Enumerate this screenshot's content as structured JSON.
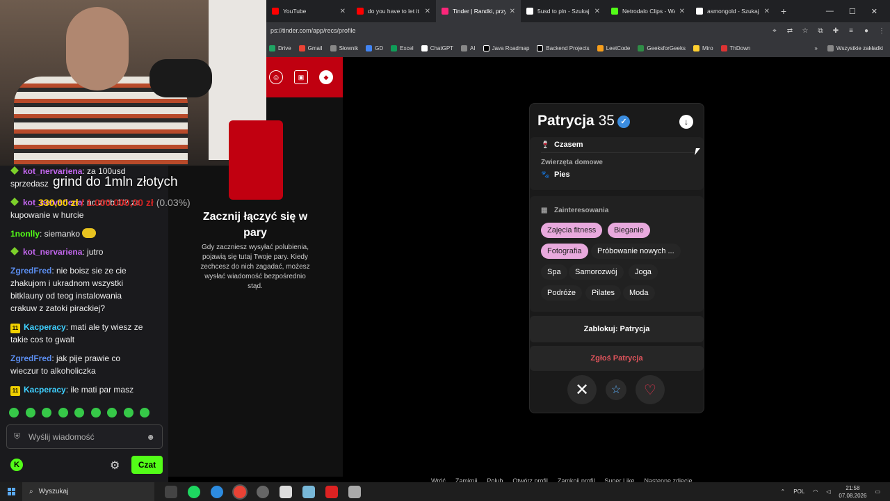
{
  "browser": {
    "tabs": [
      {
        "title": "YouTube",
        "color": "#ff0000",
        "active": false
      },
      {
        "title": "do you have to let it l...",
        "color": "#ff0000",
        "active": false
      },
      {
        "title": "Tinder | Randki, przyja...",
        "color": "#fd267a",
        "active": true
      },
      {
        "title": "5usd to pln - Szukaj w...",
        "color": "#ffffff",
        "active": false
      },
      {
        "title": "Netrodalo Clips - Wat...",
        "color": "#53fc18",
        "active": false
      },
      {
        "title": "asmongold - Szukaj w...",
        "color": "#ffffff",
        "active": false
      }
    ],
    "url": "ps://tinder.com/app/recs/profile",
    "bookmarks": [
      "Drive",
      "Gmail",
      "Słownik",
      "GD",
      "Excel",
      "ChatGPT",
      "AI",
      "Java Roadmap",
      "Backend Projects",
      "LeetCode",
      "GeeksforGeeks",
      "Miro",
      "ThDown"
    ],
    "bookmarks_all": "Wszystkie zakładki"
  },
  "tinder": {
    "empty_title": "Zacznij łączyć się w pary",
    "empty_desc": "Gdy zaczniesz wysyłać polubienia, pojawią się tutaj Twoje pary. Kiedy zechcesz do nich zagadać, możesz wysłać wiadomość bezpośrednio stąd.",
    "profile": {
      "name": "Patrycja",
      "age": "35",
      "drink_label": "Czasem",
      "pets_heading": "Zwierzęta domowe",
      "pets_value": "Pies",
      "interests_heading": "Zainteresowania",
      "interests": [
        {
          "label": "Zajęcia fitness",
          "highlight": true
        },
        {
          "label": "Bieganie",
          "highlight": true
        },
        {
          "label": "Fotografia",
          "highlight": true
        },
        {
          "label": "Próbowanie nowych ...",
          "highlight": false
        },
        {
          "label": "Spa",
          "highlight": false
        },
        {
          "label": "Samorozwój",
          "highlight": false
        },
        {
          "label": "Joga",
          "highlight": false
        },
        {
          "label": "Podróże",
          "highlight": false
        },
        {
          "label": "Pilates",
          "highlight": false
        },
        {
          "label": "Moda",
          "highlight": false
        }
      ],
      "block_label": "Zablokuj: Patrycja",
      "report_label": "Zgłoś Patrycja"
    }
  },
  "stream": {
    "overlay_text": "grind do 1mln złotych",
    "money_current": "330,00 zł",
    "money_goal": "/ 1.000.000,00 zł",
    "money_pct": "(0.03%)",
    "chat": [
      {
        "user": "kot_nervariena",
        "text": ": za 100usd sprzedasz",
        "user_color": "#c467f0",
        "badge": "gem"
      },
      {
        "user": "kot_nervariena",
        "text": ": no zrob 1/2 za kupowanie w hurcie",
        "user_color": "#c467f0",
        "badge": "gem"
      },
      {
        "user": "1nonlly",
        "text": ": siemanko",
        "user_color": "#53fc18",
        "badge": ""
      },
      {
        "user": "kot_nervariena",
        "text": ": jutro",
        "user_color": "#c467f0",
        "badge": "gem"
      },
      {
        "user": "ZgredFred",
        "text": ": nie boisz sie ze cie zhakujom i ukradnom wszystki bitklauny od teog instalowania crakuw z zatoki pirackiej?",
        "user_color": "#5b8def",
        "badge": ""
      },
      {
        "user": "Kacperacy",
        "text": ": mati ale ty wiesz ze takie cos to gwalt",
        "user_color": "#3fd0ff",
        "badge": "11"
      },
      {
        "user": "ZgredFred",
        "text": ": jak pije prawie co wieczur to alkoholiczka",
        "user_color": "#5b8def",
        "badge": ""
      },
      {
        "user": "Kacperacy",
        "text": ": ile mati par masz",
        "user_color": "#3fd0ff",
        "badge": "11"
      }
    ],
    "input_placeholder": "Wyślij wiadomość",
    "send_label": "Czat"
  },
  "hints": [
    "Wróć",
    "Zamknij",
    "Polub",
    "Otwórz profil",
    "Zamknij profil",
    "Super Like",
    "Następne zdjęcie"
  ],
  "taskbar": {
    "search_label": "Wyszukaj",
    "lang": "POL",
    "time": "21:58",
    "date": "07.08.2026"
  }
}
